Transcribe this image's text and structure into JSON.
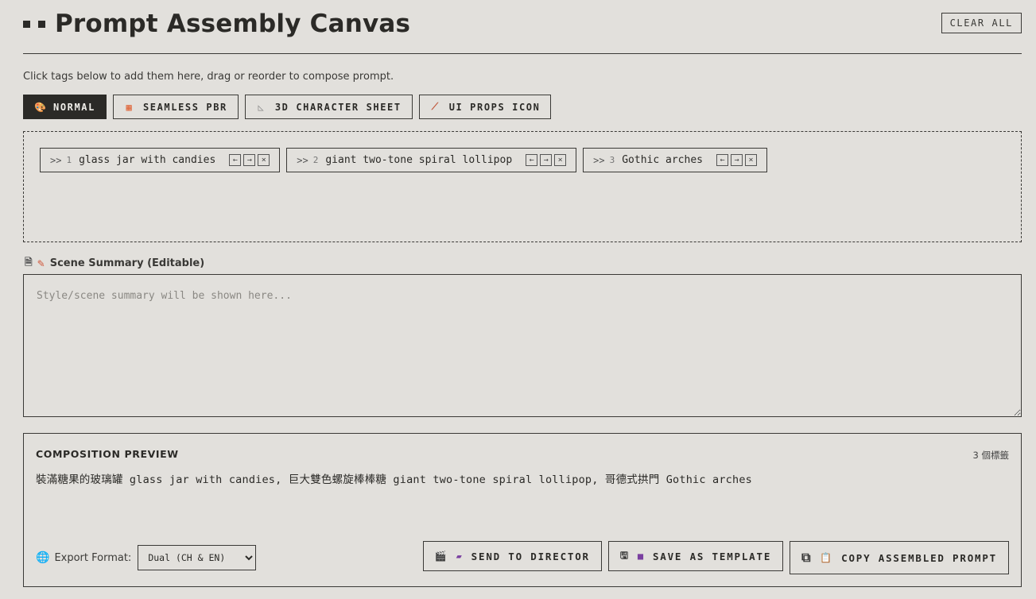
{
  "header": {
    "title": "Prompt Assembly Canvas",
    "clear_label": "CLEAR ALL"
  },
  "hint": "Click tags below to add them here, drag or reorder to compose prompt.",
  "tabs": [
    {
      "label": "NORMAL",
      "icon": "palette-icon",
      "active": true
    },
    {
      "label": "SEAMLESS PBR",
      "icon": "brick-icon",
      "active": false
    },
    {
      "label": "3D CHARACTER SHEET",
      "icon": "triangle-ruler-icon",
      "active": false
    },
    {
      "label": "UI PROPS ICON",
      "icon": "magic-wand-icon",
      "active": false
    }
  ],
  "chips": [
    {
      "drag": ">>",
      "index": "1",
      "text": "glass jar with candies"
    },
    {
      "drag": ">>",
      "index": "2",
      "text": "giant two-tone spiral lollipop"
    },
    {
      "drag": ">>",
      "index": "3",
      "text": "Gothic arches"
    }
  ],
  "chip_controls": {
    "left": "←",
    "right": "→",
    "remove": "×"
  },
  "summary": {
    "label": "Scene Summary (Editable)",
    "placeholder": "Style/scene summary will be shown here...",
    "value": ""
  },
  "preview": {
    "title": "COMPOSITION PREVIEW",
    "count": "3 個標籤",
    "text": "裝滿糖果的玻璃罐 glass jar with candies, 巨大雙色螺旋棒棒糖 giant two-tone spiral lollipop, 哥德式拱門 Gothic arches"
  },
  "export": {
    "label": "Export Format:",
    "selected": "Dual (CH & EN)"
  },
  "actions": {
    "send": "SEND TO DIRECTOR",
    "save": "SAVE AS TEMPLATE",
    "copy": "COPY ASSEMBLED PROMPT"
  },
  "colors": {
    "background": "#e2e0dc",
    "ink": "#2b2a27",
    "active_tab": "#2b2a27",
    "brick": "#e0663a",
    "clapper": "#7a3fa0",
    "floppy": "#7a3fa0",
    "clipboard": "#d98a3a"
  }
}
